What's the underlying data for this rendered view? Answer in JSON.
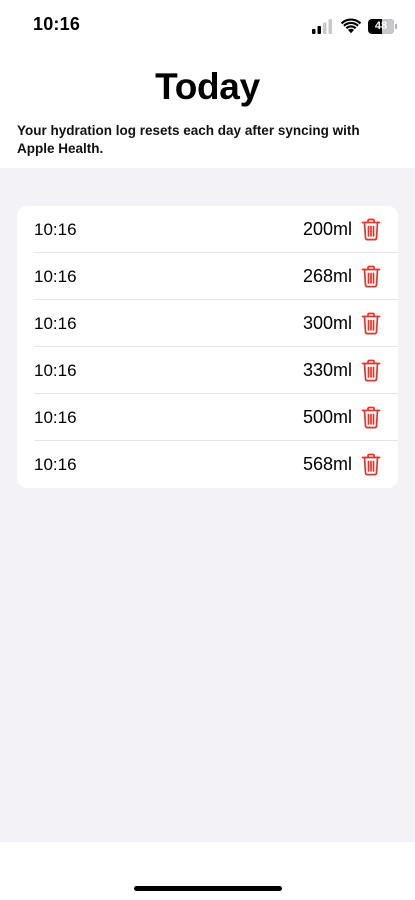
{
  "status_bar": {
    "time": "10:16",
    "battery_level": "48",
    "icons": [
      "signal-icon",
      "wifi-icon",
      "battery-icon"
    ]
  },
  "header": {
    "title": "Today",
    "subtitle": "Your hydration log resets each day after syncing with Apple Health."
  },
  "log": {
    "delete_icon": "trash-icon",
    "delete_color": "#e5342b",
    "entries": [
      {
        "time": "10:16",
        "amount": "200ml"
      },
      {
        "time": "10:16",
        "amount": "268ml"
      },
      {
        "time": "10:16",
        "amount": "300ml"
      },
      {
        "time": "10:16",
        "amount": "330ml"
      },
      {
        "time": "10:16",
        "amount": "500ml"
      },
      {
        "time": "10:16",
        "amount": "568ml"
      }
    ]
  }
}
